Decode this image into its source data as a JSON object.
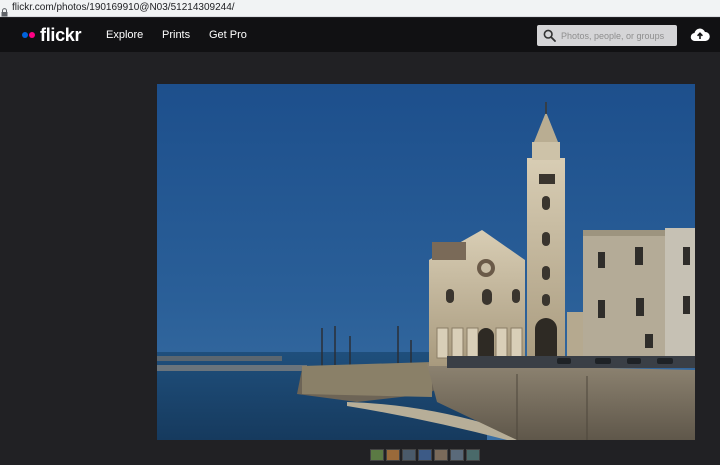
{
  "browser": {
    "url": "flickr.com/photos/190169910@N03/51214309244/"
  },
  "header": {
    "logo_text": "flickr",
    "nav": [
      "Explore",
      "Prints",
      "Get Pro"
    ],
    "search_placeholder": "Photos, people, or groups",
    "icons": {
      "search": "search-icon",
      "upload": "cloud-upload-icon",
      "lock": "lock-icon"
    }
  },
  "colors": {
    "header_bg": "#111113",
    "page_bg": "#212124",
    "flickr_blue": "#0063dc",
    "flickr_pink": "#ff0084"
  },
  "photo": {
    "subject": "cathedral-by-the-sea"
  },
  "filmstrip": {
    "thumbnails": [
      "#5b7a44",
      "#9a6a3a",
      "#4a5a6a",
      "#3c5a86",
      "#7a6a5a",
      "#5a6a7a",
      "#4a6a6a"
    ]
  }
}
